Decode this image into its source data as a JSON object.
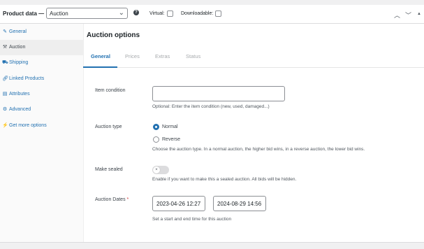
{
  "header": {
    "label": "Product data —",
    "product_type": "Auction",
    "virtual_label": "Virtual:",
    "virtual_checked": false,
    "downloadable_label": "Downloadable:",
    "downloadable_checked": false
  },
  "sidebar": {
    "items": [
      {
        "label": "General",
        "icon": "wrench-icon"
      },
      {
        "label": "Auction",
        "icon": "hammer-icon",
        "active": true
      },
      {
        "label": "Shipping",
        "icon": "truck-icon"
      },
      {
        "label": "Linked Products",
        "icon": "link-icon"
      },
      {
        "label": "Attributes",
        "icon": "list-icon"
      },
      {
        "label": "Advanced",
        "icon": "gear-icon"
      },
      {
        "label": "Get more options",
        "icon": "plugin-icon"
      }
    ]
  },
  "main": {
    "title": "Auction options",
    "tabs": [
      {
        "label": "General",
        "active": true
      },
      {
        "label": "Prices"
      },
      {
        "label": "Extras"
      },
      {
        "label": "Status"
      }
    ]
  },
  "form": {
    "item_condition": {
      "label": "Item condition",
      "value": "",
      "description": "Optional: Enter the item condition (new, used, damaged...)"
    },
    "auction_type": {
      "label": "Auction type",
      "options": [
        "Normal",
        "Reverse"
      ],
      "selected": "Normal",
      "description": "Choose the auction type. In a normal auction, the higher bid wins, in a reverse auction, the lower bid wins."
    },
    "make_sealed": {
      "label": "Make sealed",
      "enabled": false,
      "description": "Enable if you want to make this a sealed auction. All bids will be hidden."
    },
    "auction_dates": {
      "label": "Auction Dates",
      "required_mark": "*",
      "start": "2023-04-26 12:27",
      "end": "2024-08-29 14:56",
      "description": "Set a start and end time for this auction"
    }
  },
  "colors": {
    "accent": "#2271b1",
    "required": "#d63638"
  }
}
